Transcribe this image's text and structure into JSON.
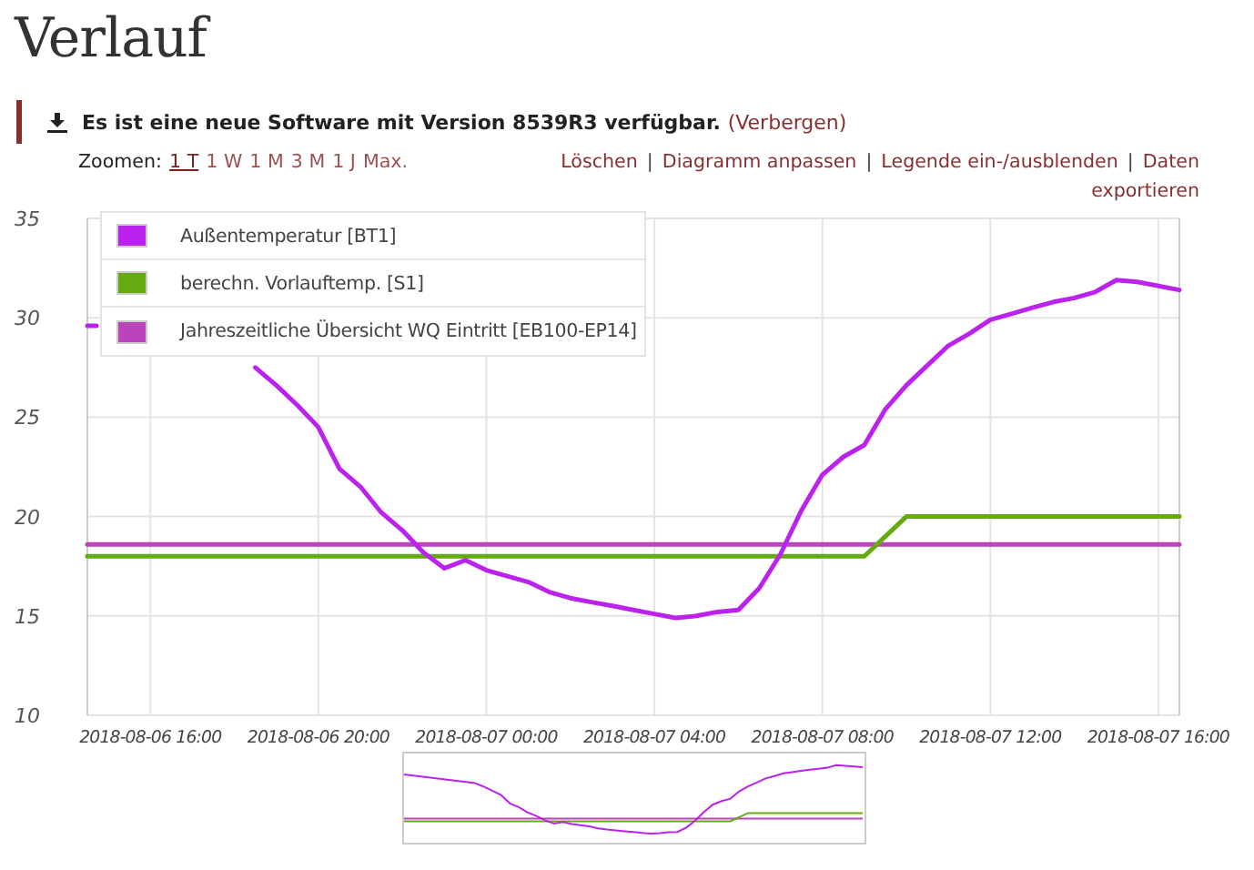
{
  "title": "Verlauf",
  "notice": {
    "message": "Es ist eine neue Software mit Version 8539R3 verfügbar.",
    "link": "(Verbergen)"
  },
  "zoom": {
    "label": "Zoomen:",
    "options": [
      {
        "label": "1 T",
        "selected": true
      },
      {
        "label": "1 W",
        "selected": false
      },
      {
        "label": "1 M",
        "selected": false
      },
      {
        "label": "3 M",
        "selected": false
      },
      {
        "label": "1 J",
        "selected": false
      },
      {
        "label": "Max.",
        "selected": false
      }
    ]
  },
  "actions": {
    "separator": "|",
    "links": [
      "Löschen",
      "Diagramm anpassen",
      "Legende ein-/ausblenden",
      "Daten exportieren"
    ]
  },
  "chart_data": {
    "type": "line",
    "grid": true,
    "ylim": [
      10,
      35
    ],
    "yticks": [
      10,
      15,
      20,
      25,
      30,
      35
    ],
    "categories": [
      null,
      null,
      null,
      "2018-08-06 16:00",
      null,
      null,
      null,
      null,
      null,
      null,
      null,
      "2018-08-06 20:00",
      null,
      null,
      null,
      null,
      null,
      null,
      null,
      "2018-08-07 00:00",
      null,
      null,
      null,
      null,
      null,
      null,
      null,
      "2018-08-07 04:00",
      null,
      null,
      null,
      null,
      null,
      null,
      null,
      "2018-08-07 08:00",
      null,
      null,
      null,
      null,
      null,
      null,
      null,
      "2018-08-07 12:00",
      null,
      null,
      null,
      null,
      null,
      null,
      null,
      "2018-08-07 16:00",
      null
    ],
    "series": [
      {
        "name": "Außentemperatur [BT1]",
        "color": "#bb22ee",
        "values": [
          29.6,
          null,
          null,
          null,
          null,
          null,
          null,
          null,
          27.5,
          26.6,
          25.6,
          24.5,
          22.4,
          21.5,
          20.2,
          19.3,
          18.2,
          17.4,
          17.8,
          17.3,
          17,
          16.7,
          16.2,
          15.9,
          15.7,
          15.5,
          15.3,
          15.1,
          14.9,
          15,
          15.2,
          15.3,
          16.4,
          18.1,
          20.3,
          22.1,
          23,
          23.6,
          25.4,
          26.6,
          27.6,
          28.6,
          29.2,
          29.9,
          30.2,
          30.5,
          30.8,
          31,
          31.3,
          31.9,
          31.8,
          31.6,
          31.4
        ]
      },
      {
        "name": "berechn. Vorlauftemp. [S1]",
        "color": "#66aa11",
        "values": [
          18,
          18,
          18,
          18,
          18,
          18,
          18,
          18,
          18,
          18,
          18,
          18,
          18,
          18,
          18,
          18,
          18,
          18,
          18,
          18,
          18,
          18,
          18,
          18,
          18,
          18,
          18,
          18,
          18,
          18,
          18,
          18,
          18,
          18,
          18,
          18,
          18,
          18,
          19,
          20,
          20,
          20,
          20,
          20,
          20,
          20,
          20,
          20,
          20,
          20,
          20,
          20,
          20
        ]
      },
      {
        "name": "Jahreszeitliche Übersicht WQ Eintritt [EB100-EP14]",
        "color": "#bb44bb",
        "values": [
          18.6,
          18.6,
          18.6,
          18.6,
          18.6,
          18.6,
          18.6,
          18.6,
          18.6,
          18.6,
          18.6,
          18.6,
          18.6,
          18.6,
          18.6,
          18.6,
          18.6,
          18.6,
          18.6,
          18.6,
          18.6,
          18.6,
          18.6,
          18.6,
          18.6,
          18.6,
          18.6,
          18.6,
          18.6,
          18.6,
          18.6,
          18.6,
          18.6,
          18.6,
          18.6,
          18.6,
          18.6,
          18.6,
          18.6,
          18.6,
          18.6,
          18.6,
          18.6,
          18.6,
          18.6,
          18.6,
          18.6,
          18.6,
          18.6,
          18.6,
          18.6,
          18.6,
          18.6
        ]
      }
    ]
  }
}
